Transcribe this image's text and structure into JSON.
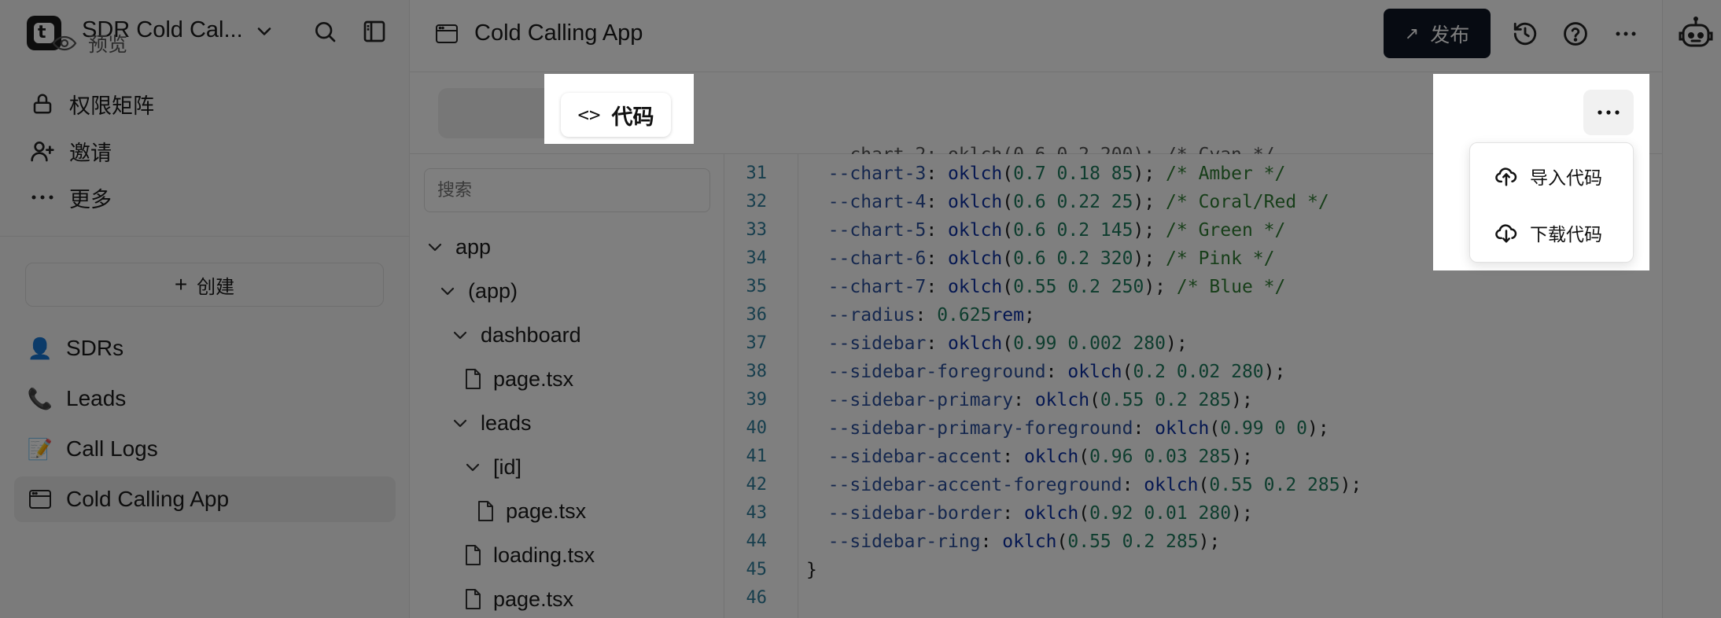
{
  "workspace": {
    "name": "SDR Cold Cal...",
    "logo_letter": "t"
  },
  "sidebar": {
    "nav": [
      {
        "label": "权限矩阵",
        "icon": "lock-icon"
      },
      {
        "label": "邀请",
        "icon": "user-plus-icon"
      },
      {
        "label": "更多",
        "icon": "more-horizontal-icon"
      }
    ],
    "create_label": "创建",
    "apps": [
      {
        "label": "SDRs",
        "emoji": "👤"
      },
      {
        "label": "Leads",
        "emoji": "📞"
      },
      {
        "label": "Call Logs",
        "emoji": "📝"
      },
      {
        "label": "Cold Calling App",
        "emoji": "",
        "active": true
      }
    ]
  },
  "topbar": {
    "title": "Cold Calling App",
    "publish_label": "发布"
  },
  "toolbar": {
    "preview_label": "预览",
    "code_label": "代码",
    "code_glyph": "<>"
  },
  "dropdown": {
    "items": [
      {
        "label": "导入代码",
        "icon": "upload-cloud-icon"
      },
      {
        "label": "下载代码",
        "icon": "download-cloud-icon"
      }
    ]
  },
  "file_tree": {
    "search_placeholder": "搜索",
    "items": [
      {
        "label": "app",
        "type": "folder",
        "level": 0
      },
      {
        "label": "(app)",
        "type": "folder",
        "level": 1
      },
      {
        "label": "dashboard",
        "type": "folder",
        "level": 2
      },
      {
        "label": "page.tsx",
        "type": "file",
        "level": 2
      },
      {
        "label": "leads",
        "type": "folder",
        "level": 2
      },
      {
        "label": "[id]",
        "type": "folder",
        "level": 3
      },
      {
        "label": "page.tsx",
        "type": "file",
        "level": 3
      },
      {
        "label": "loading.tsx",
        "type": "file",
        "level": 2
      },
      {
        "label": "page.tsx",
        "type": "file",
        "level": 2
      }
    ]
  },
  "editor": {
    "lines": [
      {
        "n": "31",
        "prop": "--chart-3",
        "fn": "oklch",
        "args": "0.7 0.18 85",
        "comment": "/* Amber */"
      },
      {
        "n": "32",
        "prop": "--chart-4",
        "fn": "oklch",
        "args": "0.6 0.22 25",
        "comment": "/* Coral/Red */"
      },
      {
        "n": "33",
        "prop": "--chart-5",
        "fn": "oklch",
        "args": "0.6 0.2 145",
        "comment": "/* Green */"
      },
      {
        "n": "34",
        "prop": "--chart-6",
        "fn": "oklch",
        "args": "0.6 0.2 320",
        "comment": "/* Pink */"
      },
      {
        "n": "35",
        "prop": "--chart-7",
        "fn": "oklch",
        "args": "0.55 0.2 250",
        "comment": "/* Blue */"
      },
      {
        "n": "36",
        "prop": "--radius",
        "value_num": "0.625",
        "value_unit": "rem"
      },
      {
        "n": "37",
        "prop": "--sidebar",
        "fn": "oklch",
        "args": "0.99 0.002 280"
      },
      {
        "n": "38",
        "prop": "--sidebar-foreground",
        "fn": "oklch",
        "args": "0.2 0.02 280"
      },
      {
        "n": "39",
        "prop": "--sidebar-primary",
        "fn": "oklch",
        "args": "0.55 0.2 285"
      },
      {
        "n": "40",
        "prop": "--sidebar-primary-foreground",
        "fn": "oklch",
        "args": "0.99 0 0"
      },
      {
        "n": "41",
        "prop": "--sidebar-accent",
        "fn": "oklch",
        "args": "0.96 0.03 285"
      },
      {
        "n": "42",
        "prop": "--sidebar-accent-foreground",
        "fn": "oklch",
        "args": "0.55 0.2 285"
      },
      {
        "n": "43",
        "prop": "--sidebar-border",
        "fn": "oklch",
        "args": "0.92 0.01 280"
      },
      {
        "n": "44",
        "prop": "--sidebar-ring",
        "fn": "oklch",
        "args": "0.55 0.2 285"
      },
      {
        "n": "45",
        "raw": "}"
      },
      {
        "n": "46",
        "raw": ""
      }
    ]
  },
  "colors": {
    "publish_bg": "#0f1725",
    "overlay": "rgba(0,0,0,0.5)",
    "line_number": "#2f7d9a",
    "code_number": "#1d7a5c",
    "code_comment": "#2e7d32"
  }
}
